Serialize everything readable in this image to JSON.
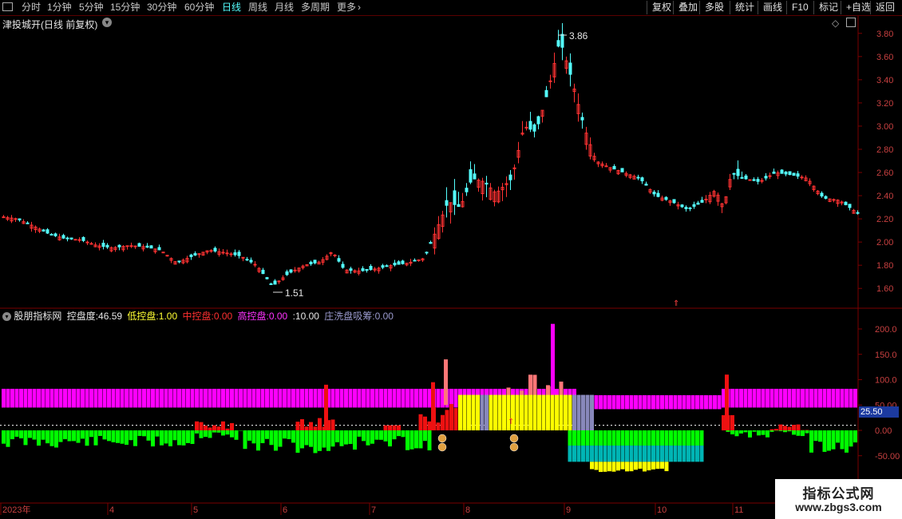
{
  "toolbar": {
    "left": [
      {
        "id": "menu",
        "label": ""
      },
      {
        "id": "fs",
        "label": "分时"
      },
      {
        "id": "m1",
        "label": "1分钟"
      },
      {
        "id": "m5",
        "label": "5分钟"
      },
      {
        "id": "m15",
        "label": "15分钟"
      },
      {
        "id": "m30",
        "label": "30分钟"
      },
      {
        "id": "m60",
        "label": "60分钟"
      },
      {
        "id": "day",
        "label": "日线"
      },
      {
        "id": "week",
        "label": "周线"
      },
      {
        "id": "month",
        "label": "月线"
      },
      {
        "id": "multi",
        "label": "多周期"
      },
      {
        "id": "more",
        "label": "更多"
      }
    ],
    "right": [
      "复权",
      "叠加",
      "多股",
      "统计",
      "画线",
      "F10",
      "标记",
      "+自选",
      "返回"
    ]
  },
  "main_panel": {
    "title": "津投城开(日线 前复权)",
    "y_ticks": [
      "3.80",
      "3.60",
      "3.40",
      "3.20",
      "3.00",
      "2.80",
      "2.60",
      "2.40",
      "2.20",
      "2.00",
      "1.80",
      "1.60"
    ],
    "high_label": "3.86",
    "low_label": "1.51"
  },
  "indicator_panel": {
    "name": "股朋指标网",
    "items": [
      {
        "label": "控盘度:",
        "value": "46.59",
        "color": "#e6e6e6"
      },
      {
        "label": "低控盘:",
        "value": "1.00",
        "color": "#ffff33"
      },
      {
        "label": "中控盘:",
        "value": "0.00",
        "color": "#ff3030"
      },
      {
        "label": "高控盘:",
        "value": "0.00",
        "color": "#ff33ff"
      },
      {
        "label": ":",
        "value": "10.00",
        "color": "#e6e6e6"
      },
      {
        "label": "庄洗盘吸筹:",
        "value": "0.00",
        "color": "#9999cc"
      }
    ],
    "y_ticks": [
      "200.0",
      "150.0",
      "100.0",
      "50.00",
      "0.00",
      "-50.00"
    ],
    "current_value": "25.50"
  },
  "x_axis": {
    "labels": [
      "2023年",
      "4",
      "5",
      "6",
      "7",
      "8",
      "9",
      "10",
      "11"
    ]
  },
  "colors": {
    "up": "#ff3232",
    "down": "#54ffff",
    "grid": "#7a0000",
    "magenta": "#ff00ff",
    "green": "#00ff00",
    "teal": "#00b4b4",
    "yellow": "#ffff00"
  },
  "watermark": {
    "line1": "指标公式网",
    "line2": "www.zbgs3.com"
  },
  "chart_data": {
    "type": "candlestick",
    "series_points": [
      {
        "x": 0,
        "y": 2.22
      },
      {
        "x": 20,
        "y": 2.2
      },
      {
        "x": 40,
        "y": 2.14
      },
      {
        "x": 60,
        "y": 2.07
      },
      {
        "x": 80,
        "y": 2.03
      },
      {
        "x": 100,
        "y": 2.02
      },
      {
        "x": 120,
        "y": 1.97
      },
      {
        "x": 140,
        "y": 1.95
      },
      {
        "x": 160,
        "y": 1.97
      },
      {
        "x": 180,
        "y": 1.96
      },
      {
        "x": 200,
        "y": 1.93
      },
      {
        "x": 220,
        "y": 1.82
      },
      {
        "x": 240,
        "y": 1.88
      },
      {
        "x": 260,
        "y": 1.93
      },
      {
        "x": 280,
        "y": 1.91
      },
      {
        "x": 300,
        "y": 1.88
      },
      {
        "x": 320,
        "y": 1.8
      },
      {
        "x": 340,
        "y": 1.62
      },
      {
        "x": 360,
        "y": 1.73
      },
      {
        "x": 380,
        "y": 1.8
      },
      {
        "x": 400,
        "y": 1.83
      },
      {
        "x": 415,
        "y": 1.92
      },
      {
        "x": 430,
        "y": 1.76
      },
      {
        "x": 450,
        "y": 1.75
      },
      {
        "x": 470,
        "y": 1.77
      },
      {
        "x": 490,
        "y": 1.8
      },
      {
        "x": 510,
        "y": 1.82
      },
      {
        "x": 530,
        "y": 1.86
      },
      {
        "x": 545,
        "y": 2.1
      },
      {
        "x": 560,
        "y": 2.35
      },
      {
        "x": 575,
        "y": 2.3
      },
      {
        "x": 590,
        "y": 2.55
      },
      {
        "x": 605,
        "y": 2.52
      },
      {
        "x": 620,
        "y": 2.42
      },
      {
        "x": 640,
        "y": 2.55
      },
      {
        "x": 655,
        "y": 3.0
      },
      {
        "x": 670,
        "y": 2.95
      },
      {
        "x": 685,
        "y": 3.3
      },
      {
        "x": 700,
        "y": 3.75
      },
      {
        "x": 715,
        "y": 3.4
      },
      {
        "x": 730,
        "y": 3.0
      },
      {
        "x": 745,
        "y": 2.7
      },
      {
        "x": 760,
        "y": 2.65
      },
      {
        "x": 780,
        "y": 2.6
      },
      {
        "x": 800,
        "y": 2.55
      },
      {
        "x": 820,
        "y": 2.4
      },
      {
        "x": 840,
        "y": 2.35
      },
      {
        "x": 860,
        "y": 2.28
      },
      {
        "x": 880,
        "y": 2.35
      },
      {
        "x": 895,
        "y": 2.45
      },
      {
        "x": 905,
        "y": 2.3
      },
      {
        "x": 915,
        "y": 2.6
      },
      {
        "x": 930,
        "y": 2.55
      },
      {
        "x": 950,
        "y": 2.52
      },
      {
        "x": 970,
        "y": 2.6
      },
      {
        "x": 990,
        "y": 2.58
      },
      {
        "x": 1010,
        "y": 2.55
      },
      {
        "x": 1030,
        "y": 2.38
      },
      {
        "x": 1050,
        "y": 2.36
      },
      {
        "x": 1075,
        "y": 2.24
      }
    ],
    "ylim": [
      1.45,
      3.95
    ]
  }
}
